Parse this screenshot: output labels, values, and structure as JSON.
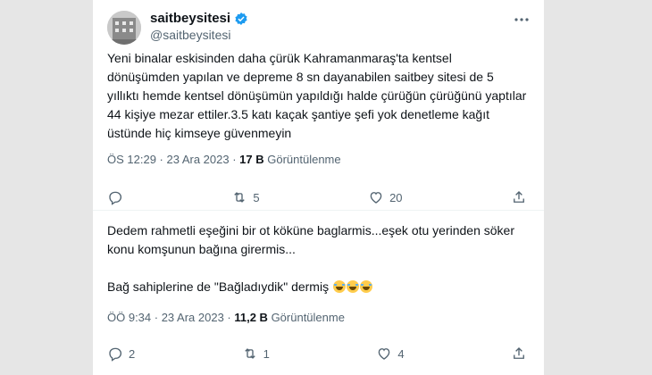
{
  "tweet1": {
    "name": "saitbeysitesi",
    "handle": "@saitbeysitesi",
    "text": "Yeni binalar eskisinden daha çürük Kahramanmaraş'ta kentsel dönüşümden yapılan ve depreme 8 sn dayanabilen saitbey sitesi de 5 yıllıktı hemde kentsel dönüşümün yapıldığı halde çürüğün çürüğünü yaptılar 44 kişiye mezar ettiler.3.5 katı kaçak şantiye şefi yok denetleme kağıt üstünde hiç kimseye güvenmeyin",
    "time": "ÖS 12:29 · 23 Ara 2023 · ",
    "views_count": "17 B",
    "views_label": " Görüntülenme",
    "reposts": "5",
    "likes": "20"
  },
  "tweet2": {
    "line1": "Dedem rahmetli eşeğini bir ot köküne baglarmis...eşek otu yerinden söker konu komşunun bağına girermis...",
    "line2": "Bağ sahiplerine de \"Bağladıydik\" dermiş",
    "time": "ÖÖ 9:34 · 23 Ara 2023 · ",
    "views_count": "11,2 B",
    "views_label": " Görüntülenme",
    "replies": "2",
    "reposts": "1",
    "likes": "4"
  },
  "colors": {
    "verified": "#1d9bf0",
    "secondary": "#536471"
  },
  "icons": [
    "avatar",
    "verified-icon",
    "more-icon",
    "reply-icon",
    "repost-icon",
    "like-icon",
    "share-icon",
    "laughing-emoji"
  ]
}
